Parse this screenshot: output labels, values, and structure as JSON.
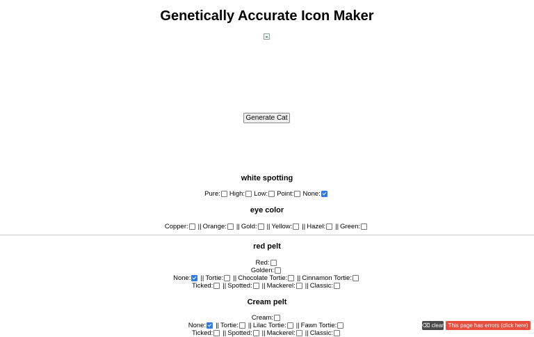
{
  "page": {
    "title": "Genetically Accurate Icon Maker"
  },
  "generate_button": "Generate Cat",
  "white_spotting": {
    "heading": "white spotting",
    "options": [
      {
        "label": "Pure:",
        "checked": false
      },
      {
        "label": "High:",
        "checked": false
      },
      {
        "label": "Low:",
        "checked": false
      },
      {
        "label": "Point:",
        "checked": false
      },
      {
        "label": "None:",
        "checked": true
      }
    ]
  },
  "eye_color": {
    "heading": "eye color",
    "options": [
      {
        "label": "Copper:",
        "checked": false
      },
      {
        "label": "Orange:",
        "checked": false
      },
      {
        "label": "Gold:",
        "checked": false
      },
      {
        "label": "Yellow:",
        "checked": false
      },
      {
        "label": "Hazel:",
        "checked": false
      },
      {
        "label": "Green:",
        "checked": false
      }
    ]
  },
  "red_pelt": {
    "heading": "red pelt",
    "base_options": [
      {
        "label": "Red:",
        "checked": false
      },
      {
        "label": "Golden:",
        "checked": false
      }
    ],
    "tortie_options": [
      {
        "label": "None:",
        "checked": true
      },
      {
        "label": "Tortie:",
        "checked": false
      },
      {
        "label": "Chocolate Tortie:",
        "checked": false
      },
      {
        "label": "Cinnamon Tortie:",
        "checked": false
      }
    ],
    "tabby_options": [
      {
        "label": "Ticked:",
        "checked": false
      },
      {
        "label": "Spotted:",
        "checked": false
      },
      {
        "label": "Mackerel:",
        "checked": false
      },
      {
        "label": "Classic:",
        "checked": false
      }
    ]
  },
  "cream_pelt": {
    "heading": "Cream pelt",
    "base_options": [
      {
        "label": "Cream:",
        "checked": false
      }
    ],
    "tortie_options": [
      {
        "label": "None:",
        "checked": true
      },
      {
        "label": "Tortie:",
        "checked": false
      },
      {
        "label": "Lilac Tortie:",
        "checked": false
      },
      {
        "label": "Fawn Tortie:",
        "checked": false
      }
    ],
    "tabby_options": [
      {
        "label": "Ticked:",
        "checked": false
      },
      {
        "label": "Spotted:",
        "checked": false
      },
      {
        "label": "Mackerel:",
        "checked": false
      },
      {
        "label": "Classic:",
        "checked": false
      }
    ]
  },
  "error_bar": {
    "clear_label": "clear",
    "error_label": "This page has errors (click here)",
    "error_color": "#e74c3c"
  }
}
